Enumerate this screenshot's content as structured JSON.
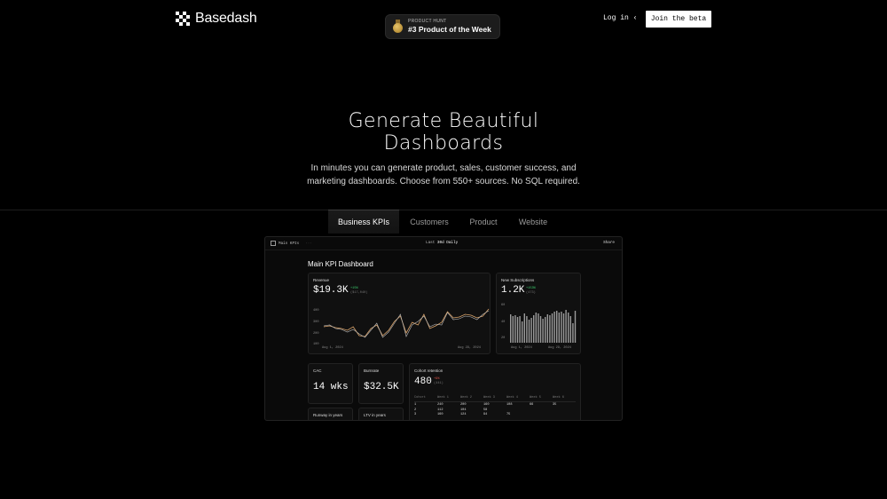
{
  "header": {
    "logo_text": "Basedash",
    "product_hunt": {
      "small": "PRODUCT HUNT",
      "big": "#3 Product of the Week",
      "icon": "medal-icon"
    },
    "login_label": "Log in",
    "login_chevron": "‹",
    "beta_label": "Join the beta"
  },
  "hero": {
    "title_line1": "Generate Beautiful",
    "title_line2": "Dashboards",
    "subtitle_line1": "In minutes you can generate product, sales, customer success, and",
    "subtitle_line2": "marketing dashboards. Choose from 550+ sources. No SQL required."
  },
  "tabs": [
    {
      "label": "Business KPIs",
      "active": true
    },
    {
      "label": "Customers",
      "active": false
    },
    {
      "label": "Product",
      "active": false
    },
    {
      "label": "Website",
      "active": false
    }
  ],
  "dashboard": {
    "topbar": {
      "crumb": "Main KPIs",
      "dots": "···",
      "range_prefix": "Last",
      "range_value": "30d",
      "interval": "Daily",
      "share": "Share"
    },
    "title": "Main KPI Dashboard",
    "revenue": {
      "label": "Revenue",
      "value": "$19.3K",
      "delta": "+15%",
      "prev": "($17,040)",
      "y_ticks": [
        "400",
        "300",
        "200",
        "100"
      ],
      "x_start": "Aug 1, 2024",
      "x_end": "Aug 29, 2024"
    },
    "subscriptions": {
      "label": "New Subscriptions",
      "value": "1.2K",
      "delta": "+153%",
      "prev": "(473)",
      "y_ticks": [
        "60",
        "40",
        "20"
      ],
      "x_start": "Aug 1, 2024",
      "x_end": "Aug 29, 2024"
    },
    "cac": {
      "label": "CAC",
      "value": "14 wks"
    },
    "burnrate": {
      "label": "Burnrate",
      "value": "$32.5K"
    },
    "runway": {
      "label": "Runway in years"
    },
    "ltv": {
      "label": "LTV in years"
    },
    "cohort": {
      "label": "Cohort retention",
      "value": "480",
      "delta": "+9%",
      "prev": "(441)",
      "headers": [
        "Cohort",
        "Week 1",
        "Week 2",
        "Week 3",
        "Week 4",
        "Week 5",
        "Week 6"
      ],
      "rows": [
        [
          "1",
          "240",
          "200",
          "160",
          "108",
          "66",
          "35"
        ],
        [
          "2",
          "112",
          "104",
          "58",
          "",
          "",
          ""
        ],
        [
          "3",
          "160",
          "124",
          "94",
          "75",
          "",
          ""
        ]
      ]
    }
  },
  "colors": {
    "accent_up": "#3ccf6e",
    "line_primary": "#d9a36a",
    "line_secondary": "#bbbbbb",
    "bar": "#9c9c9c",
    "background": "#000000"
  }
}
